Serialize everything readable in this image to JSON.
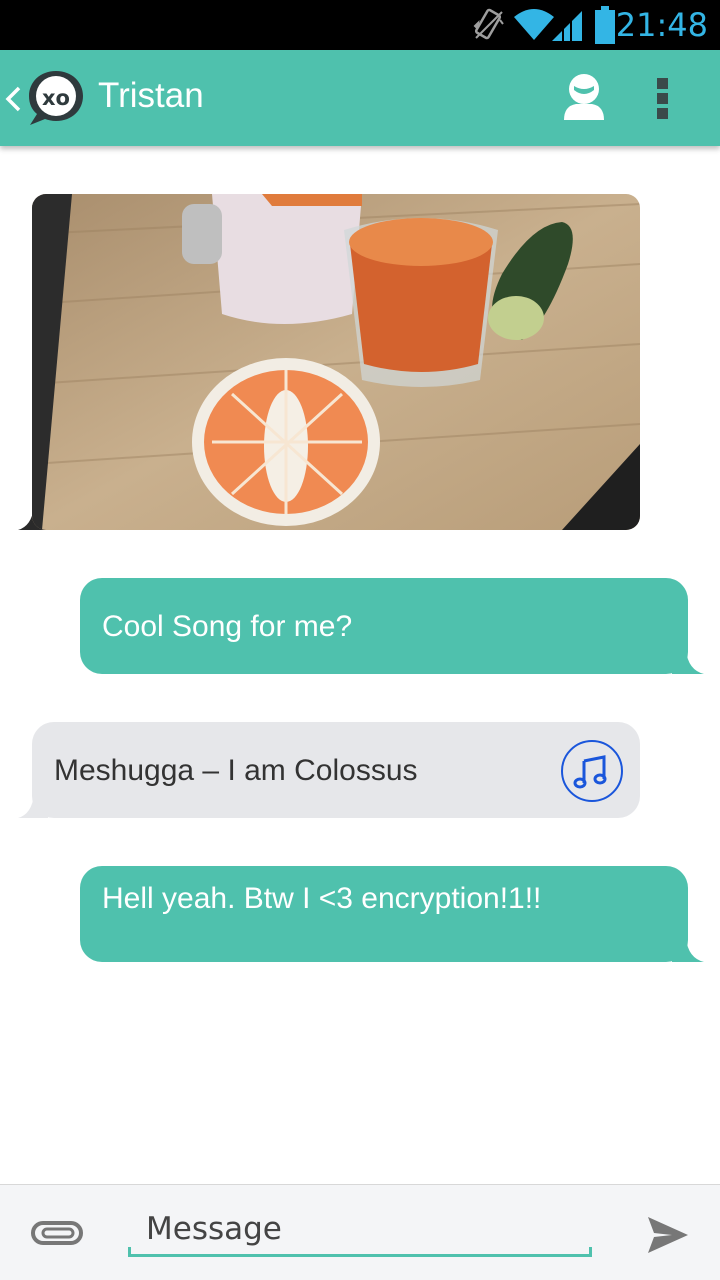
{
  "status_bar": {
    "time": "21:48"
  },
  "app_bar": {
    "title": "Tristan"
  },
  "messages": [
    {
      "type": "image",
      "direction": "incoming"
    },
    {
      "type": "text",
      "direction": "outgoing",
      "text": "Cool Song for me?"
    },
    {
      "type": "audio",
      "direction": "incoming",
      "text": "Meshugga – I am Colossus",
      "icon": "music-note-icon"
    },
    {
      "type": "text",
      "direction": "outgoing",
      "text": "Hell yeah. Btw I <3 encryption!1!!"
    }
  ],
  "composer": {
    "placeholder": "Message"
  },
  "colors": {
    "accent": "#4fc1ad",
    "incoming_bubble": "#e6e7ea",
    "status_icons": "#33b5e5",
    "music_icon": "#1a56db"
  }
}
